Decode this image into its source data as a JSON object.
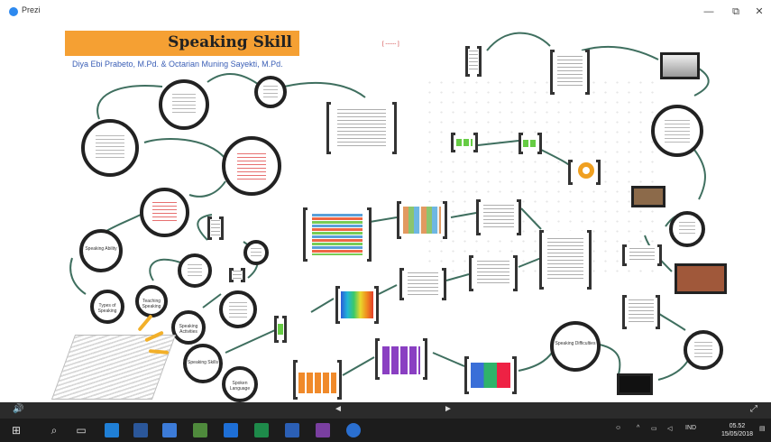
{
  "window": {
    "title": "Prezi",
    "minimize_label": "—",
    "restore_label": "⧉",
    "close_label": "✕"
  },
  "canvas": {
    "title": "Speaking Skill",
    "authors": "Diya Ebi Prabeto, M.Pd. & Octarian Muning Sayekti, M.Pd.",
    "link_text": "[ ------ ]",
    "nodes": {
      "types_of_speaking": "Types of Speaking",
      "speaking_ability": "Speaking Ability",
      "teaching_speaking": "Teaching Speaking",
      "speaking_activities": "Speaking Activities",
      "speaking_skills": "Speaking Skills",
      "spoken_language": "Spoken Language",
      "speaking_difficulties": "Speaking Difficulties"
    }
  },
  "playbar": {
    "volume_icon": "speaker-icon",
    "volume_label": "🔊",
    "prev_label": "◄",
    "next_label": "►",
    "fullscreen_label": "⤢"
  },
  "taskbar": {
    "start_label": "⊞",
    "search_label": "⌕",
    "taskview_label": "▭",
    "apps": [
      {
        "name": "edge",
        "color": "#1f7fd6"
      },
      {
        "name": "store",
        "color": "#2b579a"
      },
      {
        "name": "mail",
        "color": "#3c7bd8"
      },
      {
        "name": "photos",
        "color": "#4f8a3c"
      },
      {
        "name": "powerpoint",
        "color": "#1e6fd6"
      },
      {
        "name": "excel",
        "color": "#1e8a4a"
      },
      {
        "name": "word",
        "color": "#2b5fb5"
      },
      {
        "name": "onenote",
        "color": "#7a3fa0"
      },
      {
        "name": "prezi",
        "color": "#2a6fd0"
      }
    ],
    "language": "IND",
    "time": "05.52",
    "date": "15/05/2018"
  },
  "colors": {
    "banner": "#f5a033",
    "arrows": "#3f6f5f",
    "taskbar": "#1c1c1c"
  }
}
